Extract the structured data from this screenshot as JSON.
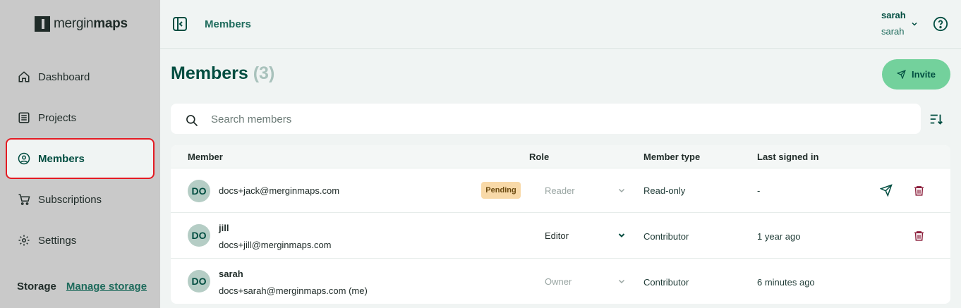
{
  "app": {
    "logo_light": "mergin",
    "logo_bold": "maps"
  },
  "sidebar": {
    "items": [
      {
        "label": "Dashboard",
        "icon": "home-icon"
      },
      {
        "label": "Projects",
        "icon": "list-icon"
      },
      {
        "label": "Members",
        "icon": "user-circle-icon",
        "active": true
      },
      {
        "label": "Subscriptions",
        "icon": "cart-icon"
      },
      {
        "label": "Settings",
        "icon": "gear-icon"
      }
    ],
    "storage_label": "Storage",
    "manage_storage": "Manage storage"
  },
  "header": {
    "breadcrumb": "Members",
    "user_name": "sarah",
    "user_workspace": "sarah"
  },
  "page": {
    "title": "Members",
    "count": "(3)",
    "invite_label": "Invite",
    "search_placeholder": "Search members"
  },
  "table": {
    "columns": [
      "Member",
      "Role",
      "Member type",
      "Last signed in"
    ],
    "rows": [
      {
        "initials": "DO",
        "name": "",
        "email": "docs+jack@merginmaps.com",
        "badge": "Pending",
        "role": "Reader",
        "role_enabled": false,
        "member_type": "Read-only",
        "last_signed": "-",
        "actions": [
          "send-icon",
          "trash-icon"
        ]
      },
      {
        "initials": "DO",
        "name": "jill",
        "email": "docs+jill@merginmaps.com",
        "badge": "",
        "role": "Editor",
        "role_enabled": true,
        "member_type": "Contributor",
        "last_signed": "1 year ago",
        "actions": [
          "trash-icon"
        ]
      },
      {
        "initials": "DO",
        "name": "sarah",
        "email": "docs+sarah@merginmaps.com (me)",
        "badge": "",
        "role": "Owner",
        "role_enabled": false,
        "member_type": "Contributor",
        "last_signed": "6 minutes ago",
        "actions": []
      }
    ]
  },
  "colors": {
    "accent": "#004d40",
    "invite_bg": "#73d19c",
    "danger": "#8b1d3a",
    "active_outline": "#e41b23",
    "pending_badge": "#f8d9a8"
  }
}
